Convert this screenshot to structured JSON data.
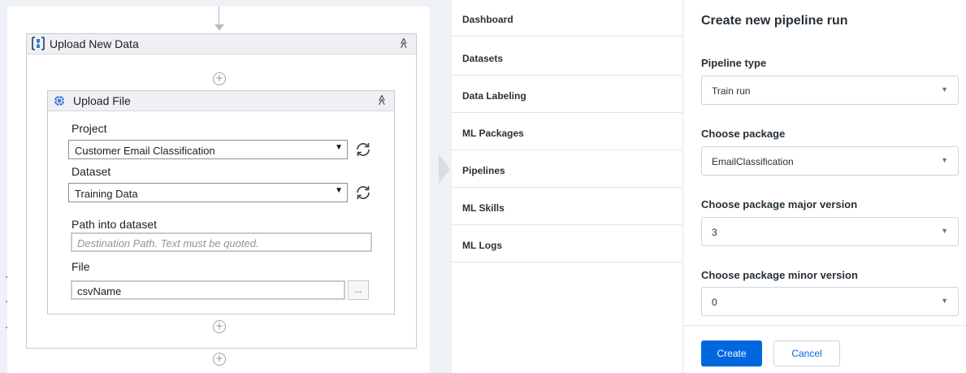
{
  "designer": {
    "sequence": {
      "title": "Upload New Data",
      "icon": "sequence-icon",
      "collapse_glyph": "≫"
    },
    "activity": {
      "title": "Upload File",
      "icon": "upload-file-icon",
      "collapse_glyph": "≫"
    },
    "add_glyph": "+",
    "fields": {
      "project_label": "Project",
      "project_value": "Customer Email Classification",
      "dataset_label": "Dataset",
      "dataset_value": "Training Data",
      "path_label": "Path into dataset",
      "path_placeholder": "Destination Path. Text must be quoted.",
      "file_label": "File",
      "file_value": "csvName",
      "browse_label": "..."
    },
    "caret_glyph": "▼"
  },
  "nav": {
    "items": [
      {
        "label": "Dashboard"
      },
      {
        "label": "Datasets"
      },
      {
        "label": "Data Labeling"
      },
      {
        "label": "ML Packages"
      },
      {
        "label": "Pipelines"
      },
      {
        "label": "ML Skills"
      },
      {
        "label": "ML Logs"
      }
    ]
  },
  "form": {
    "title": "Create new pipeline run",
    "pipeline_type_label": "Pipeline type",
    "pipeline_type_value": "Train run",
    "package_label": "Choose package",
    "package_value": "EmailClassification",
    "major_label": "Choose package major version",
    "major_value": "3",
    "minor_label": "Choose package minor version",
    "minor_value": "0",
    "create_label": "Create",
    "cancel_label": "Cancel",
    "caret_glyph": "▼"
  },
  "colors": {
    "primary": "#0067df",
    "refresh_icon": "#3a3f45"
  }
}
